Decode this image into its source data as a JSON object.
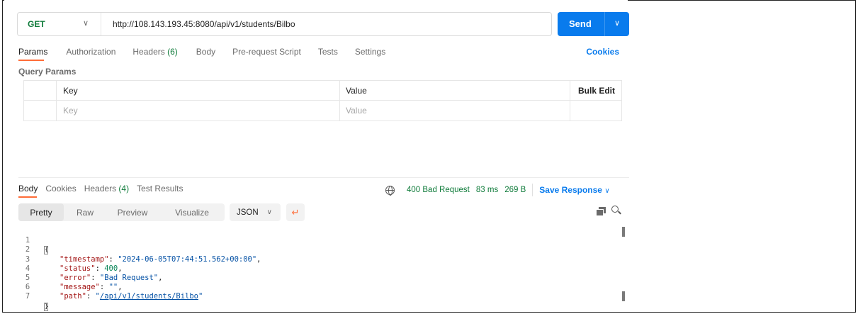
{
  "request": {
    "method": "GET",
    "url": "http://108.143.193.45:8080/api/v1/students/Bilbo",
    "send_label": "Send"
  },
  "request_tabs": [
    {
      "label": "Params",
      "active": true
    },
    {
      "label": "Authorization"
    },
    {
      "label": "Headers",
      "badge": "(6)"
    },
    {
      "label": "Body"
    },
    {
      "label": "Pre-request Script"
    },
    {
      "label": "Tests"
    },
    {
      "label": "Settings"
    }
  ],
  "cookies_label": "Cookies",
  "query_params": {
    "title": "Query Params",
    "headers": {
      "key": "Key",
      "value": "Value",
      "bulk": "Bulk Edit"
    },
    "placeholder": {
      "key": "Key",
      "value": "Value"
    }
  },
  "response_tabs": [
    {
      "label": "Body",
      "active": true
    },
    {
      "label": "Cookies"
    },
    {
      "label": "Headers",
      "badge": "(4)"
    },
    {
      "label": "Test Results"
    }
  ],
  "response_status": {
    "status": "400 Bad Request",
    "time": "83 ms",
    "size": "269 B",
    "save_label": "Save Response"
  },
  "view_modes": [
    "Pretty",
    "Raw",
    "Preview",
    "Visualize"
  ],
  "format": "JSON",
  "colors": {
    "send": "#097bed",
    "accent": "#ff6c37",
    "success": "#0f7b3a"
  },
  "code_lines": {
    "l1": {
      "num": "1",
      "open": "{"
    },
    "l2": {
      "num": "2",
      "key": "\"timestamp\"",
      "value": "\"2024-06-05T07:44:51.562+00:00\""
    },
    "l3": {
      "num": "3",
      "key": "\"status\"",
      "value": "400"
    },
    "l4": {
      "num": "4",
      "key": "\"error\"",
      "value": "\"Bad Request\""
    },
    "l5": {
      "num": "5",
      "key": "\"message\"",
      "value": "\"\""
    },
    "l6": {
      "num": "6",
      "key": "\"path\"",
      "value_q1": "\"",
      "value_link": "/api/v1/students/Bilbo",
      "value_q2": "\""
    },
    "l7": {
      "num": "7",
      "close": "}"
    }
  }
}
